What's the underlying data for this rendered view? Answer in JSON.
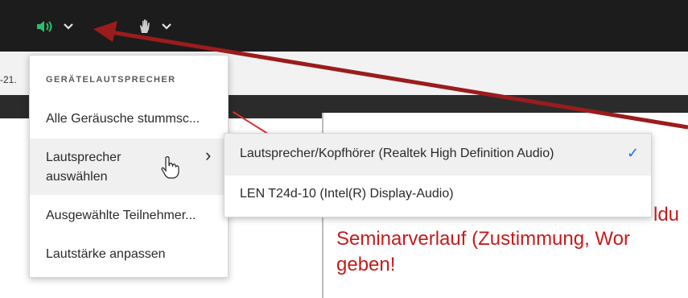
{
  "toolbar": {
    "speaker_icon": "speaker-volume-icon",
    "hand_icon": "raise-hand-icon",
    "chevron_glyph": "⌄"
  },
  "background": {
    "partial_text": "-21."
  },
  "slide": {
    "line1": "ldu",
    "line2": "Seminarverlauf (Zustimmung, Wor",
    "line3": "geben!"
  },
  "menu": {
    "header": "GERÄTELAUTSPRECHER",
    "items": [
      {
        "label": "Alle Geräusche stummsc..."
      },
      {
        "label": "Lautsprecher auswählen"
      },
      {
        "label": "Ausgewählte Teilnehmer..."
      },
      {
        "label": "Lautstärke anpassen"
      }
    ],
    "submenu_arrow": "›"
  },
  "submenu": {
    "items": [
      {
        "label": "Lautsprecher/Kopfhörer (Realtek High Definition Audio)",
        "selected": true
      },
      {
        "label": "LEN T24d-10 (Intel(R) Display-Audio)",
        "selected": false
      }
    ],
    "check_glyph": "✓"
  },
  "colors": {
    "speaker_green": "#2dbe6c",
    "accent_blue": "#1a73e8",
    "slide_red": "#c61b1b",
    "annotation_arrow": "#9b1c1c"
  }
}
